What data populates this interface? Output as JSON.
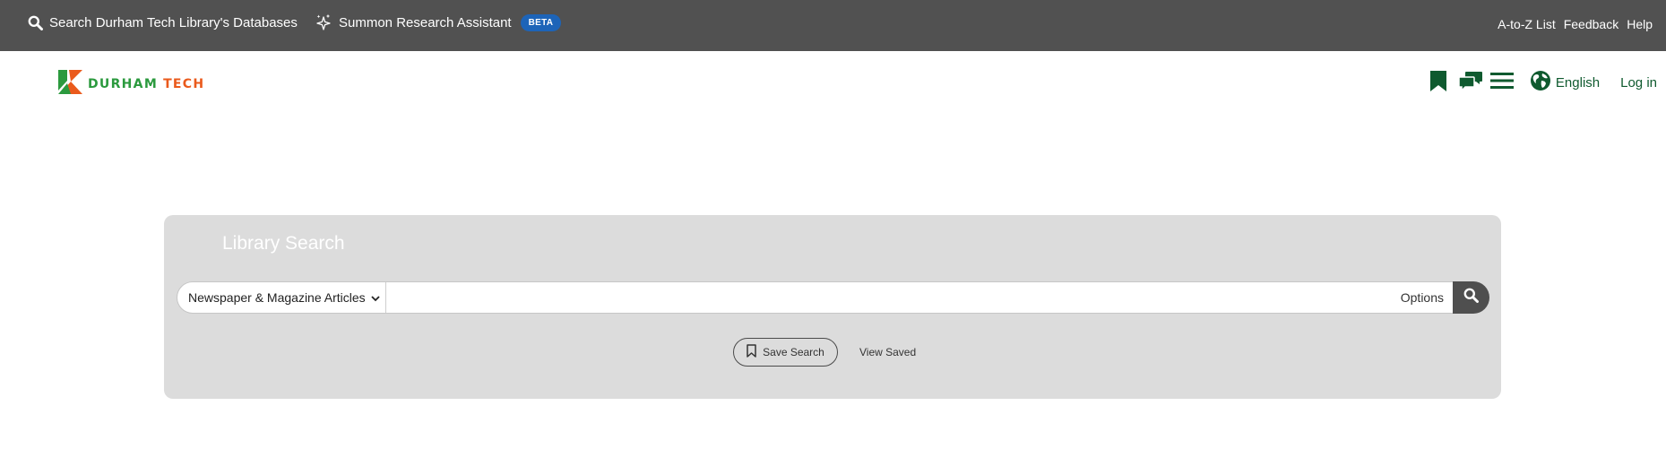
{
  "topbar": {
    "search_databases": "Search Durham Tech Library's Databases",
    "summon_assistant": "Summon Research Assistant",
    "beta_badge": "BETA",
    "links": {
      "atoz": "A-to-Z List",
      "feedback": "Feedback",
      "help": "Help"
    },
    "icons": [
      "search-icon",
      "sparkle-icon"
    ]
  },
  "header": {
    "logo_word1": "DURHAM",
    "logo_word2": "TECH",
    "language": "English",
    "login": "Log in",
    "icons": [
      "bookmark-icon",
      "chat-icon",
      "menu-icon",
      "globe-icon"
    ]
  },
  "search": {
    "title": "Library Search",
    "scope_selected": "Newspaper & Magazine Articles",
    "query_value": "",
    "query_placeholder": "",
    "options_label": "Options",
    "save_search": "Save Search",
    "view_saved": "View Saved"
  },
  "colors": {
    "topbar_bg": "#515151",
    "panel_bg": "#dcdcdc",
    "brand_green": "#2b9a3e",
    "brand_orange": "#ea5a1c",
    "header_icon_green": "#0f5a2f",
    "beta_blue": "#1d64b8",
    "search_button": "#4f4f4f"
  }
}
